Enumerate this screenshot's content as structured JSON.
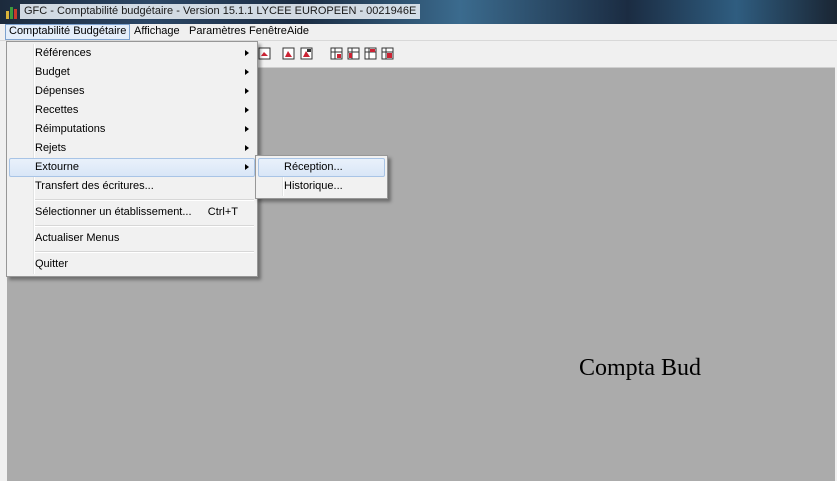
{
  "window": {
    "title": "GFC - Comptabilité budgétaire - Version 15.1.1   LYCEE EUROPEEN - 0021946E",
    "icon": "gfc-app-icon"
  },
  "menubar": {
    "items": [
      {
        "label": "Comptabilité Budgétaire",
        "active": true
      },
      {
        "label": "Affichage"
      },
      {
        "label": "Paramètres"
      },
      {
        "label": "Fenêtre"
      },
      {
        "label": "Aide"
      }
    ]
  },
  "toolbar": {
    "buttons": [
      "report-icon",
      "report-export-icon",
      "report-print-icon",
      "table-icon-1",
      "table-icon-2",
      "table-icon-3",
      "table-icon-4"
    ]
  },
  "main_menu": {
    "items": [
      {
        "label": "Références",
        "submenu": true
      },
      {
        "label": "Budget",
        "submenu": true
      },
      {
        "label": "Dépenses",
        "submenu": true
      },
      {
        "label": "Recettes",
        "submenu": true
      },
      {
        "label": "Réimputations",
        "submenu": true
      },
      {
        "label": "Rejets",
        "submenu": true
      },
      {
        "label": "Extourne",
        "submenu": true,
        "highlighted": true
      },
      {
        "label": "Transfert des écritures..."
      },
      {
        "label": "Sélectionner un établissement...",
        "shortcut": "Ctrl+T"
      },
      {
        "label": "Actualiser Menus"
      },
      {
        "label": "Quitter"
      }
    ]
  },
  "submenu": {
    "items": [
      {
        "label": "Réception...",
        "highlighted": true
      },
      {
        "label": "Historique..."
      }
    ]
  },
  "workspace": {
    "label": "Compta Bud",
    "background": "#ababab"
  }
}
